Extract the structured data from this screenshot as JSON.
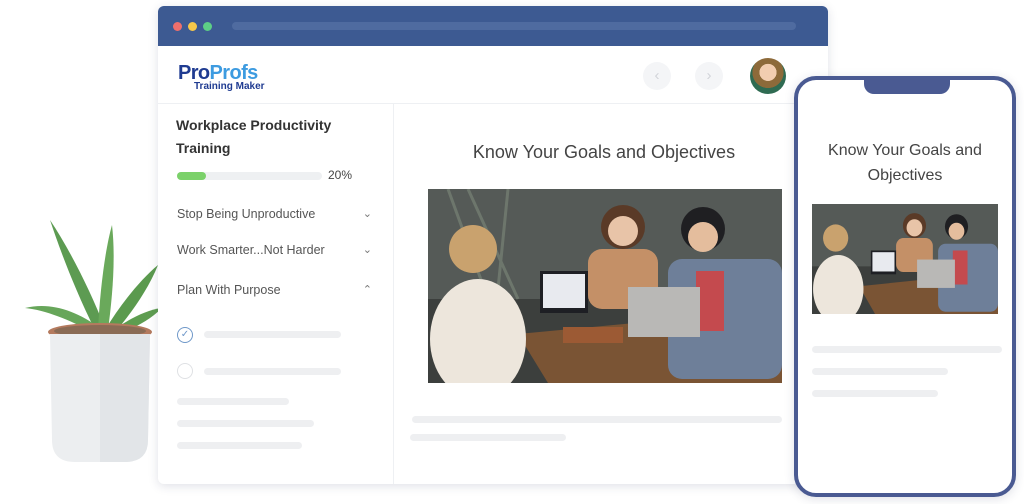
{
  "browser": {
    "window_controls": [
      "close",
      "minimize",
      "maximize"
    ]
  },
  "header": {
    "logo": {
      "primary_a": "Pro",
      "primary_b": "Profs",
      "secondary": "Training Maker"
    },
    "nav": {
      "prev_icon": "‹",
      "next_icon": "›"
    },
    "avatar_alt": "user-avatar"
  },
  "sidebar": {
    "course_title": "Workplace Productivity Training",
    "progress": {
      "value": 0.2,
      "label": "20%"
    },
    "modules": [
      {
        "label": "Stop Being Unproductive",
        "state": "collapsed",
        "chevron": "⌄"
      },
      {
        "label": "Work Smarter...Not Harder",
        "state": "collapsed",
        "chevron": "⌄"
      },
      {
        "label": "Plan With Purpose",
        "state": "expanded",
        "chevron": "⌃"
      }
    ],
    "lessons": [
      {
        "status": "completed",
        "icon": "✓"
      },
      {
        "status": "not-started",
        "icon": ""
      }
    ]
  },
  "content": {
    "title": "Know Your Goals and Objectives",
    "image_description": "Three people laughing around a table with laptops"
  },
  "phone": {
    "title": "Know Your Goals and Objectives"
  },
  "colors": {
    "titlebar": "#3d5a92",
    "brand_dark": "#1f3b91",
    "brand_light": "#3d9be0",
    "progress_fill": "#7bd16a",
    "phone_frame": "#4a5a92"
  }
}
